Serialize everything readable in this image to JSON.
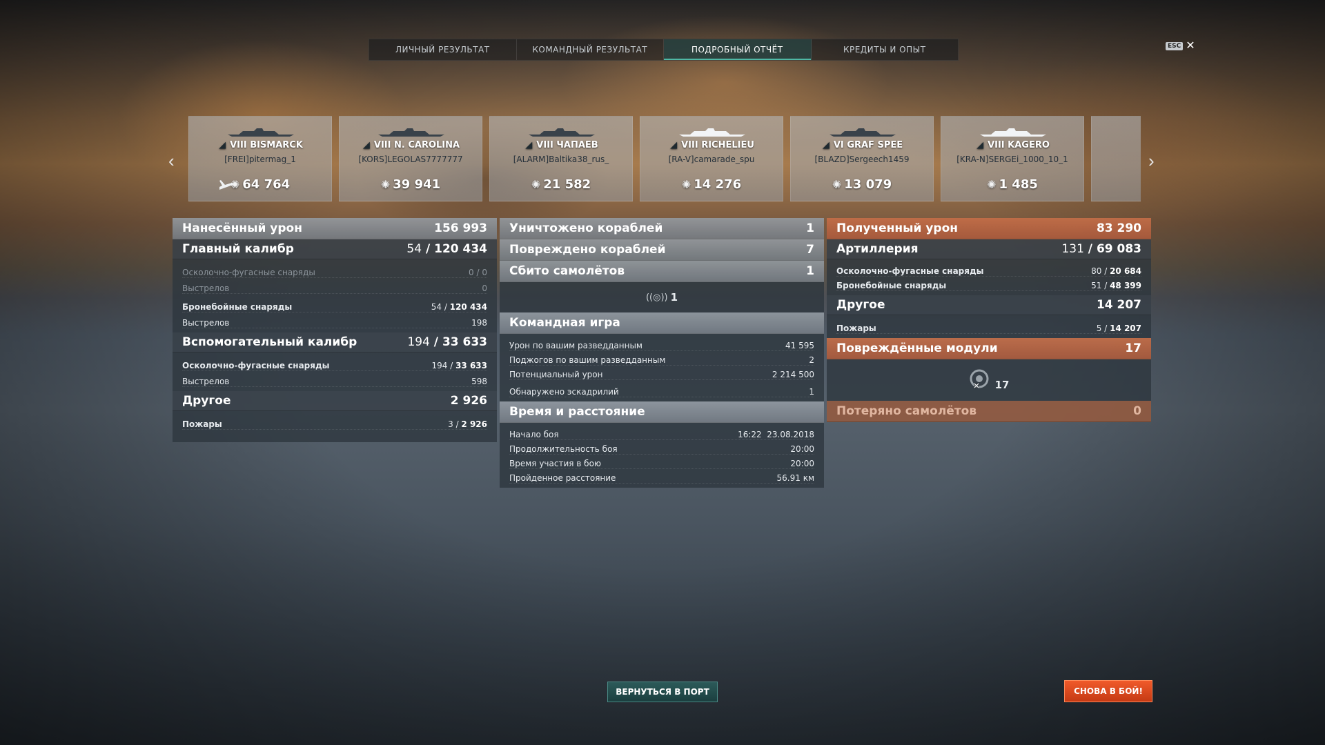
{
  "tabs": [
    "ЛИЧНЫЙ РЕЗУЛЬТАТ",
    "КОМАНДНЫЙ РЕЗУЛЬТАТ",
    "ПОДРОБНЫЙ ОТЧЁТ",
    "КРЕДИТЫ И ОПЫТ"
  ],
  "active_tab": "ПОДРОБНЫЙ ОТЧЁТ",
  "esc_label": "ESC",
  "ships": [
    {
      "tier": "VIII",
      "name": "BISMARCK",
      "player": "[FREI]pitermag_1",
      "damage": "64 764"
    },
    {
      "tier": "VIII",
      "name": "N. CAROLINA",
      "player": "[KORS]LEGOLAS7777777",
      "damage": "39 941"
    },
    {
      "tier": "VIII",
      "name": "ЧАПАЕВ",
      "player": "[ALARM]Baltika38_rus_",
      "damage": "21 582"
    },
    {
      "tier": "VIII",
      "name": "RICHELIEU",
      "player": "[RA-V]camarade_spu",
      "damage": "14 276"
    },
    {
      "tier": "VI",
      "name": "GRAF SPEE",
      "player": "[BLAZD]Sergeech1459",
      "damage": "13 079"
    },
    {
      "tier": "VIII",
      "name": "KAGERO",
      "player": "[KRA-N]SERGEi_1000_10_1",
      "damage": "1 485"
    }
  ],
  "left": {
    "dealt": {
      "title": "Нанесённый урон",
      "value": "156 993"
    },
    "main": {
      "title": "Главный калибр",
      "a": "54",
      "b": "120 434"
    },
    "main_rows": [
      {
        "label": "Осколочно-фугасные снаряды",
        "value": "0 / 0"
      },
      {
        "label": "Выстрелов",
        "value": "0"
      },
      {
        "label": "Бронебойные снаряды",
        "a": "54",
        "b": "120 434"
      },
      {
        "label": "Выстрелов",
        "value": "198"
      }
    ],
    "secondary": {
      "title": "Вспомогательный калибр",
      "a": "194",
      "b": "33 633"
    },
    "secondary_rows": [
      {
        "label": "Осколочно-фугасные снаряды",
        "a": "194",
        "b": "33 633"
      },
      {
        "label": "Выстрелов",
        "value": "598"
      }
    ],
    "other": {
      "title": "Другое",
      "value": "2 926"
    },
    "other_rows": [
      {
        "label": "Пожары",
        "a": "3",
        "b": "2 926"
      }
    ]
  },
  "mid": {
    "destroyed": {
      "title": "Уничтожено кораблей",
      "value": "1"
    },
    "damaged": {
      "title": "Повреждено кораблей",
      "value": "7"
    },
    "planes": {
      "title": "Сбито самолётов",
      "value": "1"
    },
    "spotted_count": "1",
    "team": {
      "title": "Командная игра"
    },
    "team_rows": [
      {
        "label": "Урон по вашим разведданным",
        "value": "41 595"
      },
      {
        "label": "Поджогов по вашим разведданным",
        "value": "2"
      },
      {
        "label": "Потенциальный урон",
        "value": "2 214 500"
      },
      {
        "label": "Обнаружено эскадрилий",
        "value": "1"
      }
    ],
    "time": {
      "title": "Время и расстояние"
    },
    "time_rows": [
      {
        "label": "Начало боя",
        "value": "16:22  23.08.2018"
      },
      {
        "label": "Продолжительность боя",
        "value": "20:00"
      },
      {
        "label": "Время участия в бою",
        "value": "20:00"
      },
      {
        "label": "Пройденное расстояние",
        "value": "56.91 км"
      }
    ]
  },
  "right": {
    "received": {
      "title": "Полученный урон",
      "value": "83 290"
    },
    "artillery": {
      "title": "Артиллерия",
      "a": "131",
      "b": "69 083"
    },
    "artillery_rows": [
      {
        "label": "Осколочно-фугасные снаряды",
        "a": "80",
        "b": "20 684"
      },
      {
        "label": "Бронебойные снаряды",
        "a": "51",
        "b": "48 399"
      }
    ],
    "other": {
      "title": "Другое",
      "value": "14 207"
    },
    "other_rows": [
      {
        "label": "Пожары",
        "a": "5",
        "b": "14 207"
      }
    ],
    "modules": {
      "title": "Повреждённые модули",
      "value": "17"
    },
    "modules_count": "17",
    "planes_lost": {
      "title": "Потеряно самолётов",
      "value": "0"
    }
  },
  "buttons": {
    "port": "ВЕРНУТЬСЯ В ПОРТ",
    "again": "СНОВА В БОЙ!"
  },
  "colors": {
    "accent_teal": "#4fb8a5",
    "accent_orange": "#e8502a"
  }
}
